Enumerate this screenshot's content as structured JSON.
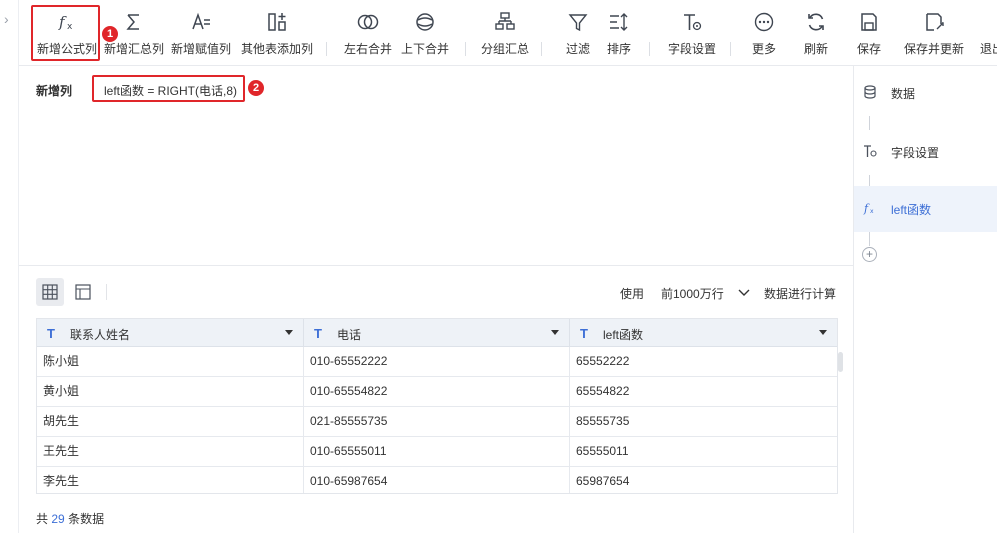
{
  "toolbar": {
    "items": [
      {
        "label": "新增公式列",
        "icon": "function-icon"
      },
      {
        "label": "新增汇总列",
        "icon": "sigma-icon"
      },
      {
        "label": "新增赋值列",
        "icon": "assign-icon"
      },
      {
        "label": "其他表添加列",
        "icon": "add-column-icon"
      },
      {
        "label": "左右合并",
        "icon": "merge-horizontal-icon"
      },
      {
        "label": "上下合并",
        "icon": "merge-vertical-icon"
      },
      {
        "label": "分组汇总",
        "icon": "group-icon"
      },
      {
        "label": "过滤",
        "icon": "filter-icon"
      },
      {
        "label": "排序",
        "icon": "sort-icon"
      },
      {
        "label": "字段设置",
        "icon": "field-settings-icon"
      },
      {
        "label": "更多",
        "icon": "more-icon"
      },
      {
        "label": "刷新",
        "icon": "refresh-icon"
      },
      {
        "label": "保存",
        "icon": "save-icon"
      },
      {
        "label": "保存并更新",
        "icon": "save-update-icon"
      },
      {
        "label": "退出",
        "icon": "exit-icon"
      }
    ]
  },
  "annotations": {
    "badge1": "1",
    "badge2": "2"
  },
  "editor": {
    "label": "新增列",
    "formula": "left函数 = RIGHT(电话,8)"
  },
  "preview": {
    "use_label": "使用",
    "rows_option": "前1000万行",
    "calc_label": "数据进行计算",
    "columns": [
      {
        "type": "T",
        "name": "联系人姓名"
      },
      {
        "type": "T",
        "name": "电话"
      },
      {
        "type": "T",
        "name": "left函数"
      }
    ],
    "rows": [
      [
        "陈小姐",
        "010-65552222",
        "65552222"
      ],
      [
        "黄小姐",
        "010-65554822",
        "65554822"
      ],
      [
        "胡先生",
        "021-85555735",
        "85555735"
      ],
      [
        "王先生",
        "010-65555011",
        "65555011"
      ],
      [
        "李先生",
        "010-65987654",
        "65987654"
      ]
    ],
    "footer_prefix": "共",
    "footer_count": "29",
    "footer_suffix": "条数据"
  },
  "steps": [
    {
      "label": "数据",
      "icon": "database-icon"
    },
    {
      "label": "字段设置",
      "icon": "field-settings-icon"
    },
    {
      "label": "left函数",
      "icon": "function-icon"
    }
  ],
  "colors": {
    "accent": "#3d6fd6",
    "highlight": "#e0262a",
    "active_step_bg": "#eef3fb",
    "header_bg": "#eef2f7"
  }
}
